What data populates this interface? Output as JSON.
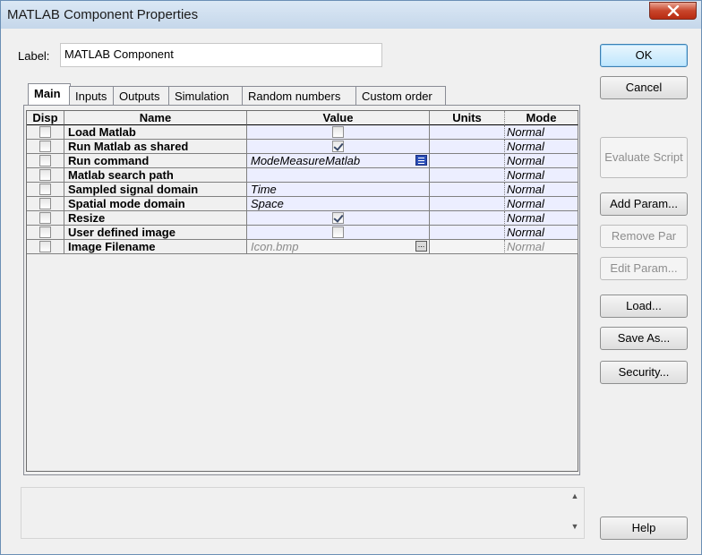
{
  "window": {
    "title": "MATLAB Component Properties"
  },
  "label": {
    "caption": "Label:",
    "value": "MATLAB Component"
  },
  "tabs": [
    {
      "label": "Main",
      "active": true
    },
    {
      "label": "Inputs",
      "active": false
    },
    {
      "label": "Outputs",
      "active": false
    },
    {
      "label": "Simulation",
      "active": false
    },
    {
      "label": "Random numbers",
      "active": false
    },
    {
      "label": "Custom order",
      "active": false
    }
  ],
  "grid": {
    "headers": {
      "disp": "Disp",
      "name": "Name",
      "value": "Value",
      "units": "Units",
      "mode": "Mode"
    },
    "rows": [
      {
        "name": "Load Matlab",
        "value": "",
        "value_type": "checkbox",
        "value_checked": false,
        "units": "",
        "mode": "Normal"
      },
      {
        "name": "Run Matlab as shared",
        "value": "",
        "value_type": "checkbox",
        "value_checked": true,
        "units": "",
        "mode": "Normal"
      },
      {
        "name": "Run command",
        "value": "ModeMeasureMatlab",
        "value_type": "list",
        "units": "",
        "mode": "Normal"
      },
      {
        "name": "Matlab search path",
        "value": "",
        "value_type": "text",
        "units": "",
        "mode": "Normal"
      },
      {
        "name": "Sampled signal domain",
        "value": "Time",
        "value_type": "text",
        "units": "",
        "mode": "Normal"
      },
      {
        "name": "Spatial mode domain",
        "value": "Space",
        "value_type": "text",
        "units": "",
        "mode": "Normal"
      },
      {
        "name": "Resize",
        "value": "",
        "value_type": "checkbox",
        "value_checked": true,
        "units": "",
        "mode": "Normal"
      },
      {
        "name": "User defined image",
        "value": "",
        "value_type": "checkbox",
        "value_checked": false,
        "units": "",
        "mode": "Normal"
      },
      {
        "name": "Image Filename",
        "value": "Icon.bmp",
        "value_type": "file",
        "units": "",
        "mode": "Normal"
      }
    ],
    "browse_label": "..."
  },
  "buttons": {
    "ok": "OK",
    "cancel": "Cancel",
    "evaluate_script": "Evaluate Script",
    "add_param": "Add Param...",
    "remove_par": "Remove Par",
    "edit_param": "Edit Param...",
    "load": "Load...",
    "save_as": "Save As...",
    "security": "Security...",
    "help": "Help"
  },
  "colors": {
    "titlebar": "#c5d7ea",
    "close": "#c8452b",
    "value_cell": "#eceeff",
    "default_button": "#3c7fb1"
  }
}
